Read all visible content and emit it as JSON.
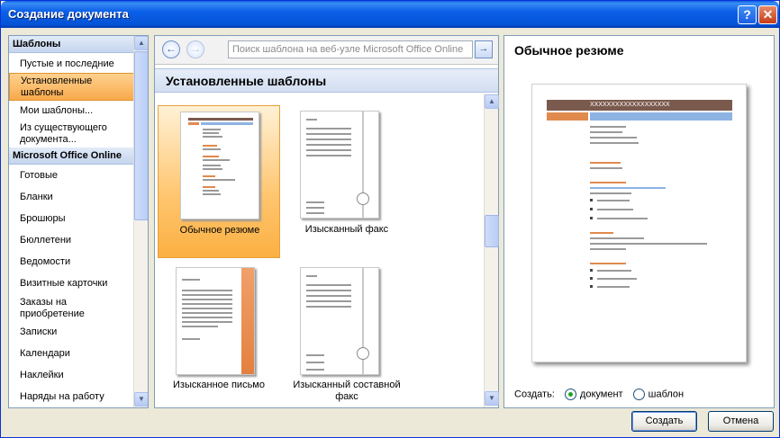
{
  "window": {
    "title": "Создание документа",
    "help": "?",
    "close": "✕"
  },
  "sidebar": {
    "header_templates": "Шаблоны",
    "items_top": [
      {
        "label": "Пустые и последние"
      },
      {
        "label": "Установленные шаблоны",
        "selected": true
      },
      {
        "label": "Мои шаблоны..."
      },
      {
        "label": "Из существующего документа..."
      }
    ],
    "header_online": "Microsoft Office Online",
    "items_online": [
      {
        "label": "Готовые"
      },
      {
        "label": "Бланки"
      },
      {
        "label": "Брошюры"
      },
      {
        "label": "Бюллетени"
      },
      {
        "label": "Ведомости"
      },
      {
        "label": "Визитные карточки"
      },
      {
        "label": "Заказы на приобретение"
      },
      {
        "label": "Записки"
      },
      {
        "label": "Календари"
      },
      {
        "label": "Наклейки"
      },
      {
        "label": "Наряды на работу"
      }
    ]
  },
  "nav": {
    "back": "←",
    "forward": "→",
    "search_placeholder": "Поиск шаблона на веб-узле Microsoft Office Online",
    "go": "→"
  },
  "gallery": {
    "title": "Установленные шаблоны",
    "templates": [
      {
        "label": "Обычное резюме",
        "selected": true
      },
      {
        "label": "Изысканный факс"
      },
      {
        "label": "Изысканное письмо"
      },
      {
        "label": "Изысканный составной факс"
      }
    ]
  },
  "preview": {
    "title": "Обычное резюме",
    "name_bar": "XXXXXXXXXXXXXXXXXXX",
    "create_label": "Создать:",
    "option_document": "документ",
    "option_template": "шаблон",
    "selected_option": "document"
  },
  "buttons": {
    "create": "Создать",
    "cancel": "Отмена"
  },
  "colors": {
    "accent_orange": "#e08a4d",
    "resume_header_brown": "#7b5a4e",
    "resume_header_blue": "#8db3e2",
    "selection_orange": "#f8a94b"
  }
}
